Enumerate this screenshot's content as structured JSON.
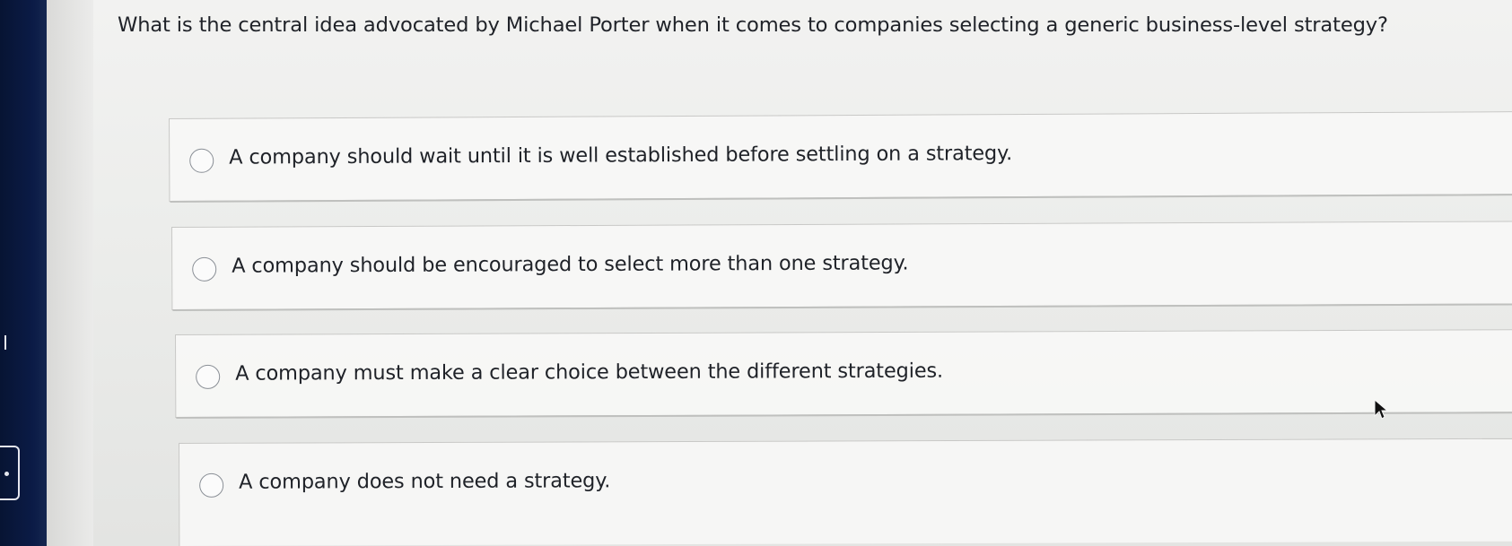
{
  "question": {
    "text": "What is the central idea advocated by Michael Porter when it comes to companies selecting a generic business-level strategy?"
  },
  "options": [
    {
      "label": "A company should wait until it is well established before settling on a strategy.",
      "selected": false
    },
    {
      "label": "A company should be encouraged to select more than one strategy.",
      "selected": false
    },
    {
      "label": "A company must make a clear choice between the different strategies.",
      "selected": false
    },
    {
      "label": "A company does not need a strategy.",
      "selected": false
    }
  ],
  "icons": {
    "radio": "radio-button-icon",
    "cursor": "mouse-cursor-icon"
  },
  "colors": {
    "question_text": "#1f2228",
    "option_border": "#c8c8c6",
    "radio_border": "#8a8f96",
    "sidebar_background": "#0f1c3e"
  }
}
